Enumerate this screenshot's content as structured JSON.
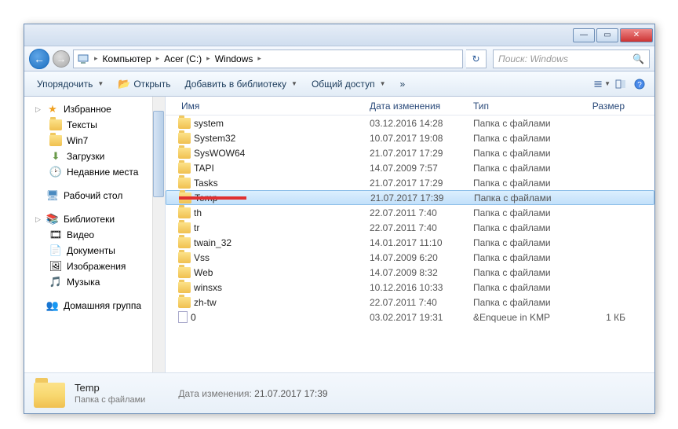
{
  "titlebar": {
    "min": "—",
    "max": "▭",
    "close": "✕"
  },
  "nav": {
    "back": "←",
    "fwd": "→",
    "refresh": "↻"
  },
  "breadcrumb": {
    "segments": [
      "Компьютер",
      "Acer (C:)",
      "Windows"
    ],
    "arrow": "▸"
  },
  "search": {
    "placeholder": "Поиск: Windows",
    "icon": "🔍"
  },
  "toolbar": {
    "organize": "Упорядочить",
    "open": "Открыть",
    "add_to_library": "Добавить в библиотеку",
    "share": "Общий доступ",
    "drop": "▼"
  },
  "sidebar": {
    "favorites": {
      "label": "Избранное",
      "exp": "▷",
      "items": [
        {
          "label": "Тексты"
        },
        {
          "label": "Win7"
        },
        {
          "label": "Загрузки"
        },
        {
          "label": "Недавние места"
        }
      ]
    },
    "desktop": {
      "label": "Рабочий стол"
    },
    "libraries": {
      "label": "Библиотеки",
      "exp": "▷",
      "items": [
        {
          "label": "Видео"
        },
        {
          "label": "Документы"
        },
        {
          "label": "Изображения"
        },
        {
          "label": "Музыка"
        }
      ]
    },
    "homegroup": {
      "label": "Домашняя группа"
    }
  },
  "columns": {
    "name": "Имя",
    "date": "Дата изменения",
    "type": "Тип",
    "size": "Размер"
  },
  "rows": [
    {
      "name": "system",
      "date": "03.12.2016 14:28",
      "type": "Папка с файлами",
      "size": "",
      "kind": "folder"
    },
    {
      "name": "System32",
      "date": "10.07.2017 19:08",
      "type": "Папка с файлами",
      "size": "",
      "kind": "folder"
    },
    {
      "name": "SysWOW64",
      "date": "21.07.2017 17:29",
      "type": "Папка с файлами",
      "size": "",
      "kind": "folder"
    },
    {
      "name": "TAPI",
      "date": "14.07.2009 7:57",
      "type": "Папка с файлами",
      "size": "",
      "kind": "folder"
    },
    {
      "name": "Tasks",
      "date": "21.07.2017 17:29",
      "type": "Папка с файлами",
      "size": "",
      "kind": "folder"
    },
    {
      "name": "Temp",
      "date": "21.07.2017 17:39",
      "type": "Папка с файлами",
      "size": "",
      "kind": "folder",
      "selected": true,
      "marked": true
    },
    {
      "name": "th",
      "date": "22.07.2011 7:40",
      "type": "Папка с файлами",
      "size": "",
      "kind": "folder"
    },
    {
      "name": "tr",
      "date": "22.07.2011 7:40",
      "type": "Папка с файлами",
      "size": "",
      "kind": "folder"
    },
    {
      "name": "twain_32",
      "date": "14.01.2017 11:10",
      "type": "Папка с файлами",
      "size": "",
      "kind": "folder"
    },
    {
      "name": "Vss",
      "date": "14.07.2009 6:20",
      "type": "Папка с файлами",
      "size": "",
      "kind": "folder"
    },
    {
      "name": "Web",
      "date": "14.07.2009 8:32",
      "type": "Папка с файлами",
      "size": "",
      "kind": "folder"
    },
    {
      "name": "winsxs",
      "date": "10.12.2016 10:33",
      "type": "Папка с файлами",
      "size": "",
      "kind": "folder"
    },
    {
      "name": "zh-tw",
      "date": "22.07.2011 7:40",
      "type": "Папка с файлами",
      "size": "",
      "kind": "folder"
    },
    {
      "name": "0",
      "date": "03.02.2017 19:31",
      "type": "&Enqueue in KMP",
      "size": "1 КБ",
      "kind": "file"
    }
  ],
  "details": {
    "name": "Temp",
    "type": "Папка с файлами",
    "date_label": "Дата изменения:",
    "date_value": "21.07.2017 17:39"
  }
}
